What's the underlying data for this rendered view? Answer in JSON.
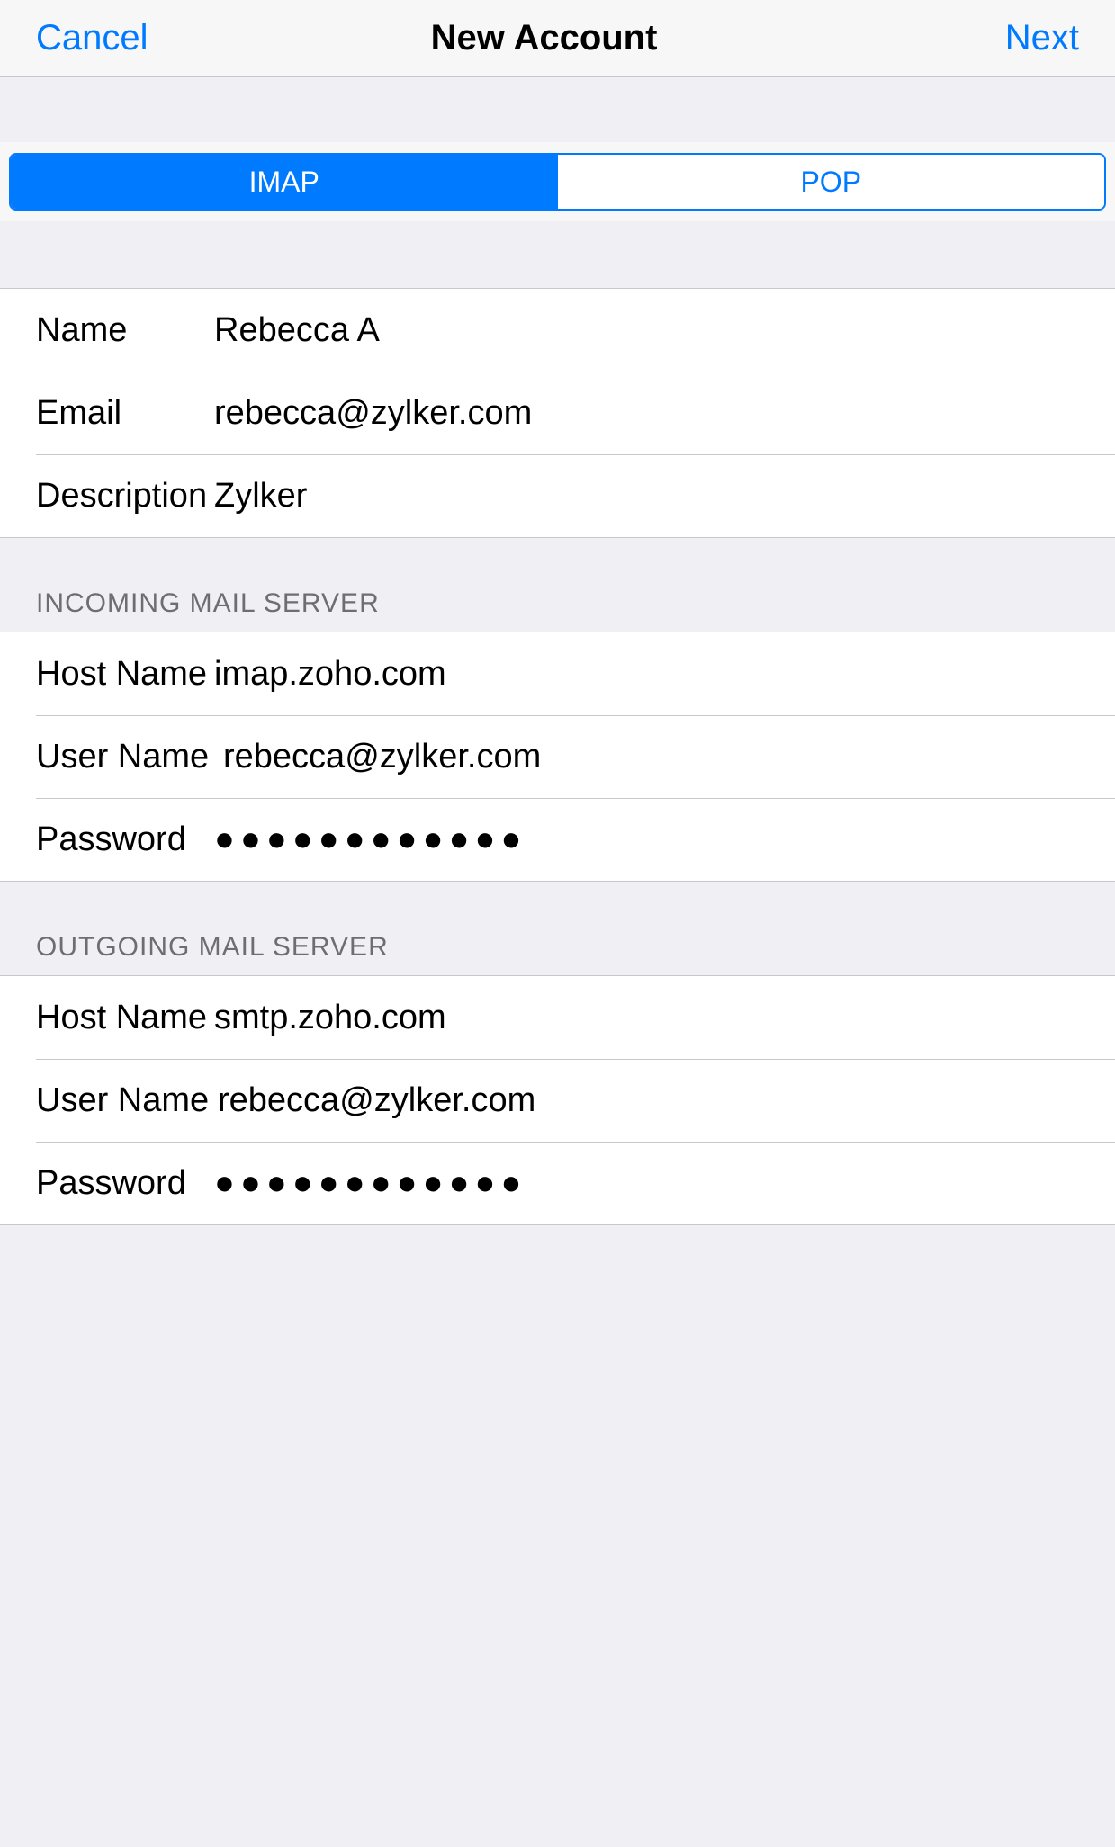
{
  "navbar": {
    "cancel": "Cancel",
    "title": "New Account",
    "next": "Next"
  },
  "segmented": {
    "imap": "IMAP",
    "pop": "POP",
    "active": "imap"
  },
  "account": {
    "name_label": "Name",
    "name_value": "Rebecca A",
    "email_label": "Email",
    "email_value": "rebecca@zylker.com",
    "description_label": "Description",
    "description_value": "Zylker"
  },
  "incoming": {
    "header": "INCOMING MAIL SERVER",
    "host_label": "Host Name",
    "host_value": "imap.zoho.com",
    "user_label": "User Name",
    "user_value": "rebecca@zylker.com",
    "password_label": "Password",
    "password_mask": "●●●●●●●●●●●●"
  },
  "outgoing": {
    "header": "OUTGOING MAIL SERVER",
    "host_label": "Host Name",
    "host_value": "smtp.zoho.com",
    "user_label": "User Name",
    "user_value": "rebecca@zylker.com",
    "password_label": "Password",
    "password_mask": "●●●●●●●●●●●●"
  }
}
